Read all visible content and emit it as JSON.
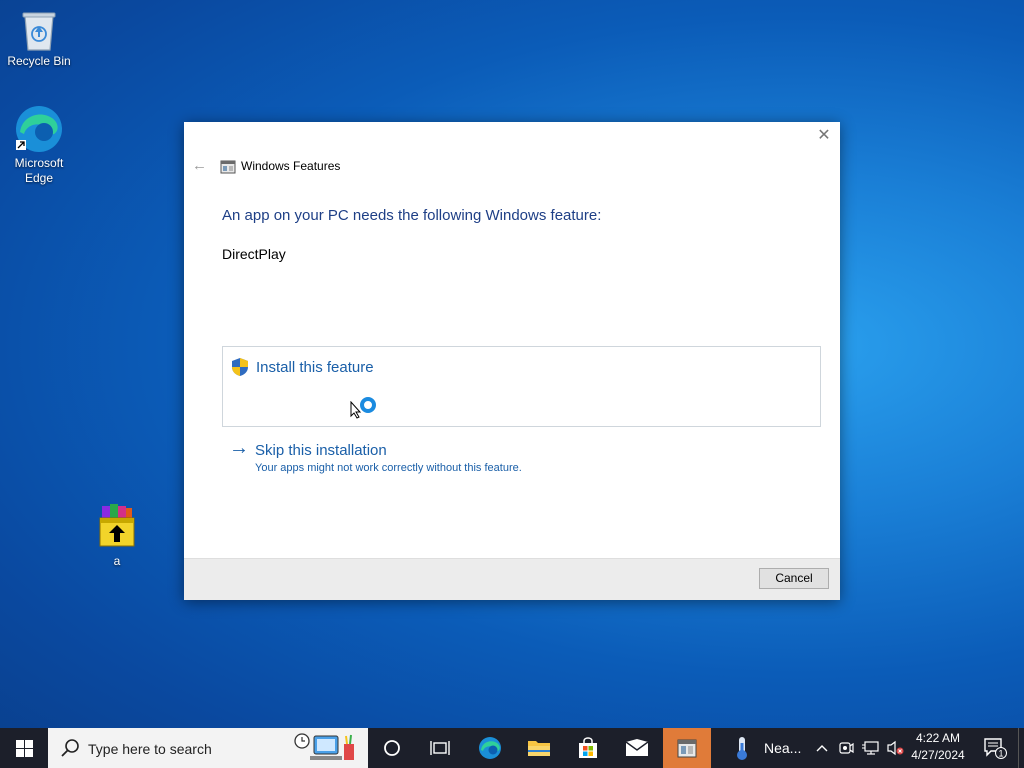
{
  "desktop": {
    "icons": [
      {
        "label": "Recycle Bin"
      },
      {
        "label": "Microsoft Edge"
      },
      {
        "label": "a"
      }
    ]
  },
  "dialog": {
    "title": "Windows Features",
    "heading": "An app on your PC needs the following Windows feature:",
    "feature_name": "DirectPlay",
    "install_label": "Install this feature",
    "skip_label": "Skip this installation",
    "skip_sub": "Your apps might not work correctly without this feature.",
    "cancel_label": "Cancel"
  },
  "taskbar": {
    "search_placeholder": "Type here to search",
    "weather_text": "Nea...",
    "time": "4:22 AM",
    "date": "4/27/2024",
    "notification_count": "1"
  },
  "colors": {
    "accent": "#1a5fa8",
    "heading": "#1e3f86",
    "taskbar": "#1c1f2a"
  }
}
